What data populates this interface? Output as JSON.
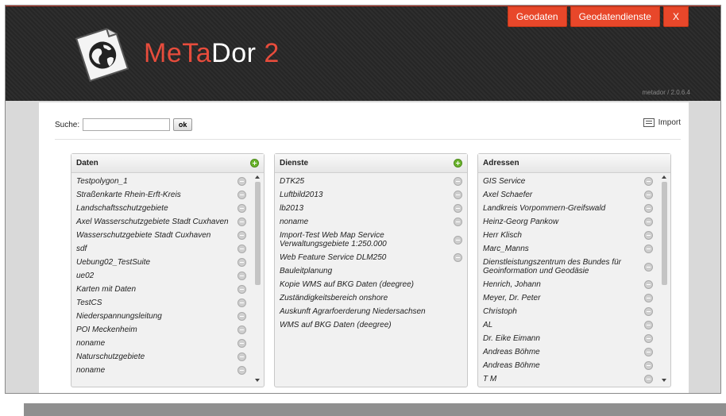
{
  "app": {
    "logo_part_red": "MeTa",
    "logo_part_white": "Dor",
    "logo_part_red2": "2",
    "version": "metador / 2.0.6.4"
  },
  "topnav": {
    "geodaten": "Geodaten",
    "geodatendienste": "Geodatendienste",
    "close": "X"
  },
  "search": {
    "label": "Suche:",
    "value": "",
    "button": "ok"
  },
  "import_label": "Import",
  "panels": {
    "daten": {
      "title": "Daten",
      "items": [
        "Testpolygon_1",
        "Straßenkarte Rhein-Erft-Kreis",
        "Landschaftsschutzgebiete",
        "Axel Wasserschutzgebiete Stadt Cuxhaven",
        "Wasserschutzgebiete Stadt Cuxhaven",
        "sdf",
        "Uebung02_TestSuite",
        "ue02",
        "Karten mit Daten",
        "TestCS",
        "Niederspannungsleitung",
        "POI Meckenheim",
        "noname",
        "Naturschutzgebiete",
        "noname"
      ]
    },
    "dienste": {
      "title": "Dienste",
      "items": [
        "DTK25",
        "Luftbild2013",
        "lb2013",
        "noname",
        "Import-Test Web Map Service Verwaltungsgebiete 1:250.000",
        "Web Feature Service DLM250",
        "Bauleitplanung",
        "Kopie WMS auf BKG Daten (deegree)",
        "Zuständigkeitsbereich onshore",
        "Auskunft Agrarfoerderung Niedersachsen",
        "WMS auf BKG Daten (deegree)"
      ]
    },
    "adressen": {
      "title": "Adressen",
      "items": [
        "GIS Service",
        "Axel Schaefer",
        "Landkreis Vorpommern-Greifswald",
        "Heinz-Georg Pankow",
        "Herr Klisch",
        "Marc_Manns",
        "Dienstleistungszentrum des Bundes für Geoinformation und Geodäsie",
        "Henrich, Johann",
        "Meyer, Dr. Peter",
        "Christoph",
        "AL",
        "Dr. Eike Eimann",
        "Andreas Böhme",
        "Andreas Böhme",
        "T M"
      ]
    }
  },
  "colors": {
    "accent": "#e8472a",
    "add_green": "#6ab42c",
    "header_bg": "#2a2a2a"
  }
}
